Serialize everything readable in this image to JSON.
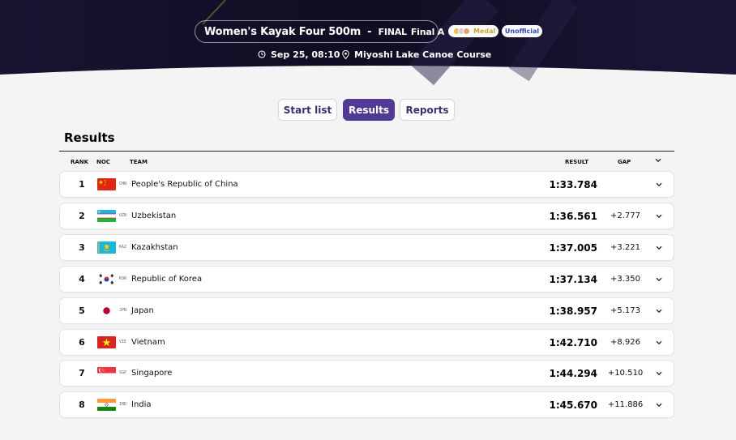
{
  "event": {
    "name": "Women's Kayak Four 500m",
    "separator": "-",
    "phase": "FINAL",
    "unit": "Final A",
    "medal_badge": "Medal",
    "status_badge": "Unofficial",
    "date": "Sep 25, 08:10",
    "venue": "Miyoshi Lake Canoe Course"
  },
  "tabs": [
    {
      "label": "Start list",
      "active": false
    },
    {
      "label": "Results",
      "active": true
    },
    {
      "label": "Reports",
      "active": false
    }
  ],
  "section_title": "Results",
  "columns": {
    "rank": "RANK",
    "noc": "NOC",
    "team": "TEAM",
    "result": "RESULT",
    "gap": "GAP"
  },
  "rows": [
    {
      "rank": "1",
      "noc": "CHN",
      "team": "People's Republic of China",
      "result": "1:33.784",
      "gap": ""
    },
    {
      "rank": "2",
      "noc": "UZB",
      "team": "Uzbekistan",
      "result": "1:36.561",
      "gap": "+2.777"
    },
    {
      "rank": "3",
      "noc": "KAZ",
      "team": "Kazakhstan",
      "result": "1:37.005",
      "gap": "+3.221"
    },
    {
      "rank": "4",
      "noc": "KOR",
      "team": "Republic of Korea",
      "result": "1:37.134",
      "gap": "+3.350"
    },
    {
      "rank": "5",
      "noc": "JPN",
      "team": "Japan",
      "result": "1:38.957",
      "gap": "+5.173"
    },
    {
      "rank": "6",
      "noc": "VIE",
      "team": "Vietnam",
      "result": "1:42.710",
      "gap": "+8.926"
    },
    {
      "rank": "7",
      "noc": "SGP",
      "team": "Singapore",
      "result": "1:44.294",
      "gap": "+10.510"
    },
    {
      "rank": "8",
      "noc": "IND",
      "team": "India",
      "result": "1:45.670",
      "gap": "+11.886"
    }
  ],
  "icons": {
    "date": "clock-icon",
    "venue": "location-pin-icon",
    "expand": "chevron-down-icon"
  },
  "colors": {
    "header_bg": "#151028",
    "accent": "#4f3b93",
    "medal_gold": "#e5c15a",
    "unofficial": "#2f46b8"
  }
}
